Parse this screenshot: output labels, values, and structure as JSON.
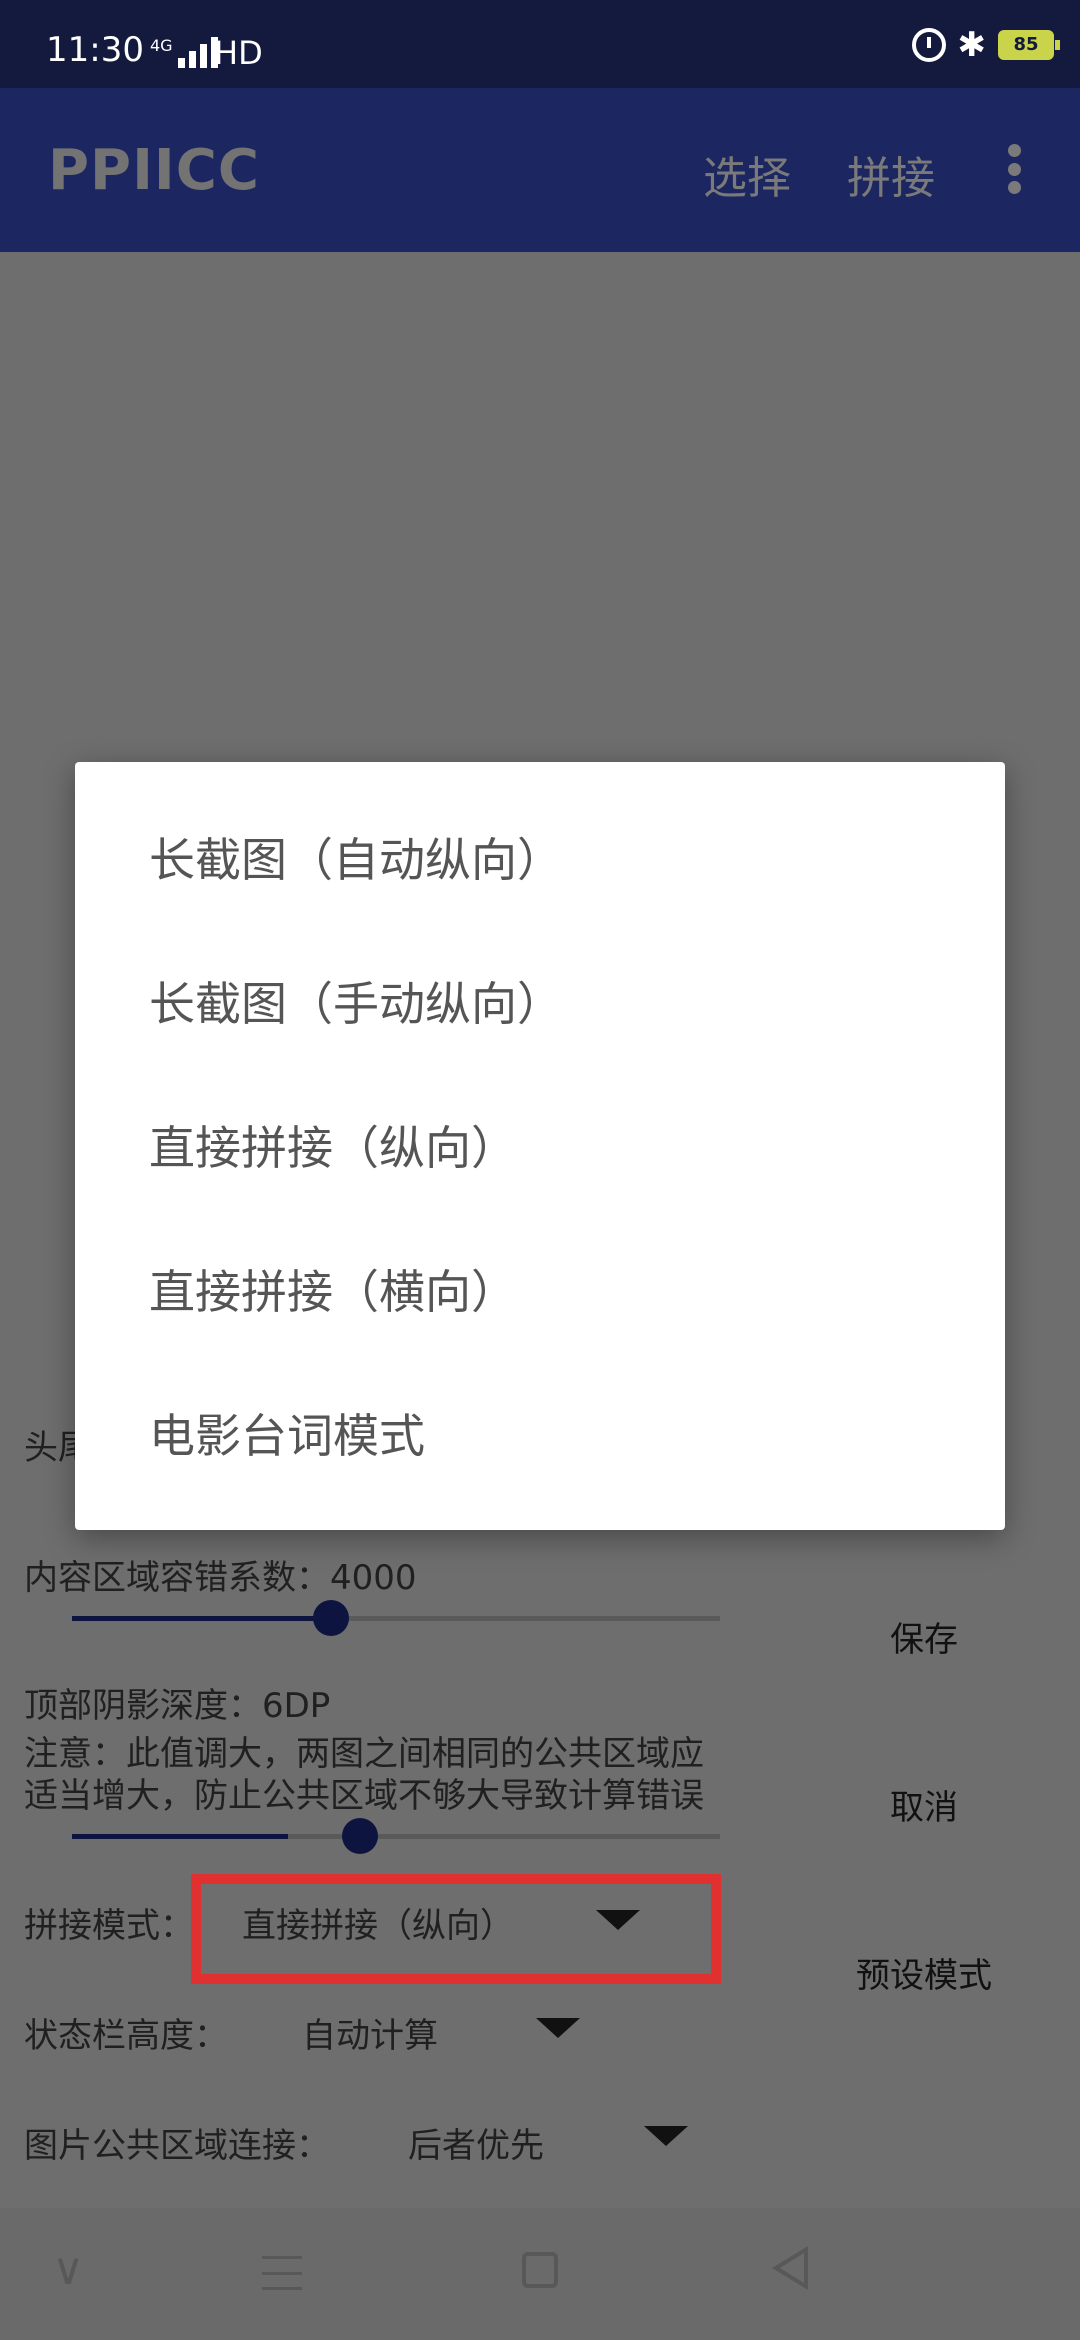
{
  "status_bar": {
    "time": "11:30",
    "network": "4G",
    "hd": "HD",
    "battery": "85"
  },
  "app_bar": {
    "title": "PPIICC",
    "actions": [
      "选择",
      "拼接"
    ]
  },
  "panel": {
    "header_partial": "头尾",
    "content_tolerance_label": "内容区域容错系数：4000",
    "content_tolerance_value": 0.4,
    "shadow_depth_label": "顶部阴影深度：6DP",
    "note_line1": "注意：此值调大，两图之间相同的公共区域应",
    "note_line2": "适当增大，防止公共区域不够大导致计算错误",
    "shadow_depth_value": 0.33,
    "stitch_mode_label": "拼接模式：",
    "stitch_mode_value": "直接拼接（纵向）",
    "statusbar_height_label": "状态栏高度：",
    "statusbar_height_value": "自动计算",
    "common_area_label": "图片公共区域连接：",
    "common_area_value": "后者优先",
    "save_button": "保存",
    "cancel_button": "取消",
    "preset_button": "预设模式"
  },
  "dialog": {
    "options": [
      "长截图（自动纵向）",
      "长截图（手动纵向）",
      "直接拼接（纵向）",
      "直接拼接（横向）",
      "电影台词模式"
    ]
  },
  "colors": {
    "app_bar": "#1c2660",
    "status_bar": "#14193e",
    "highlight": "#e03030",
    "scrim": "#6e6e6e"
  }
}
